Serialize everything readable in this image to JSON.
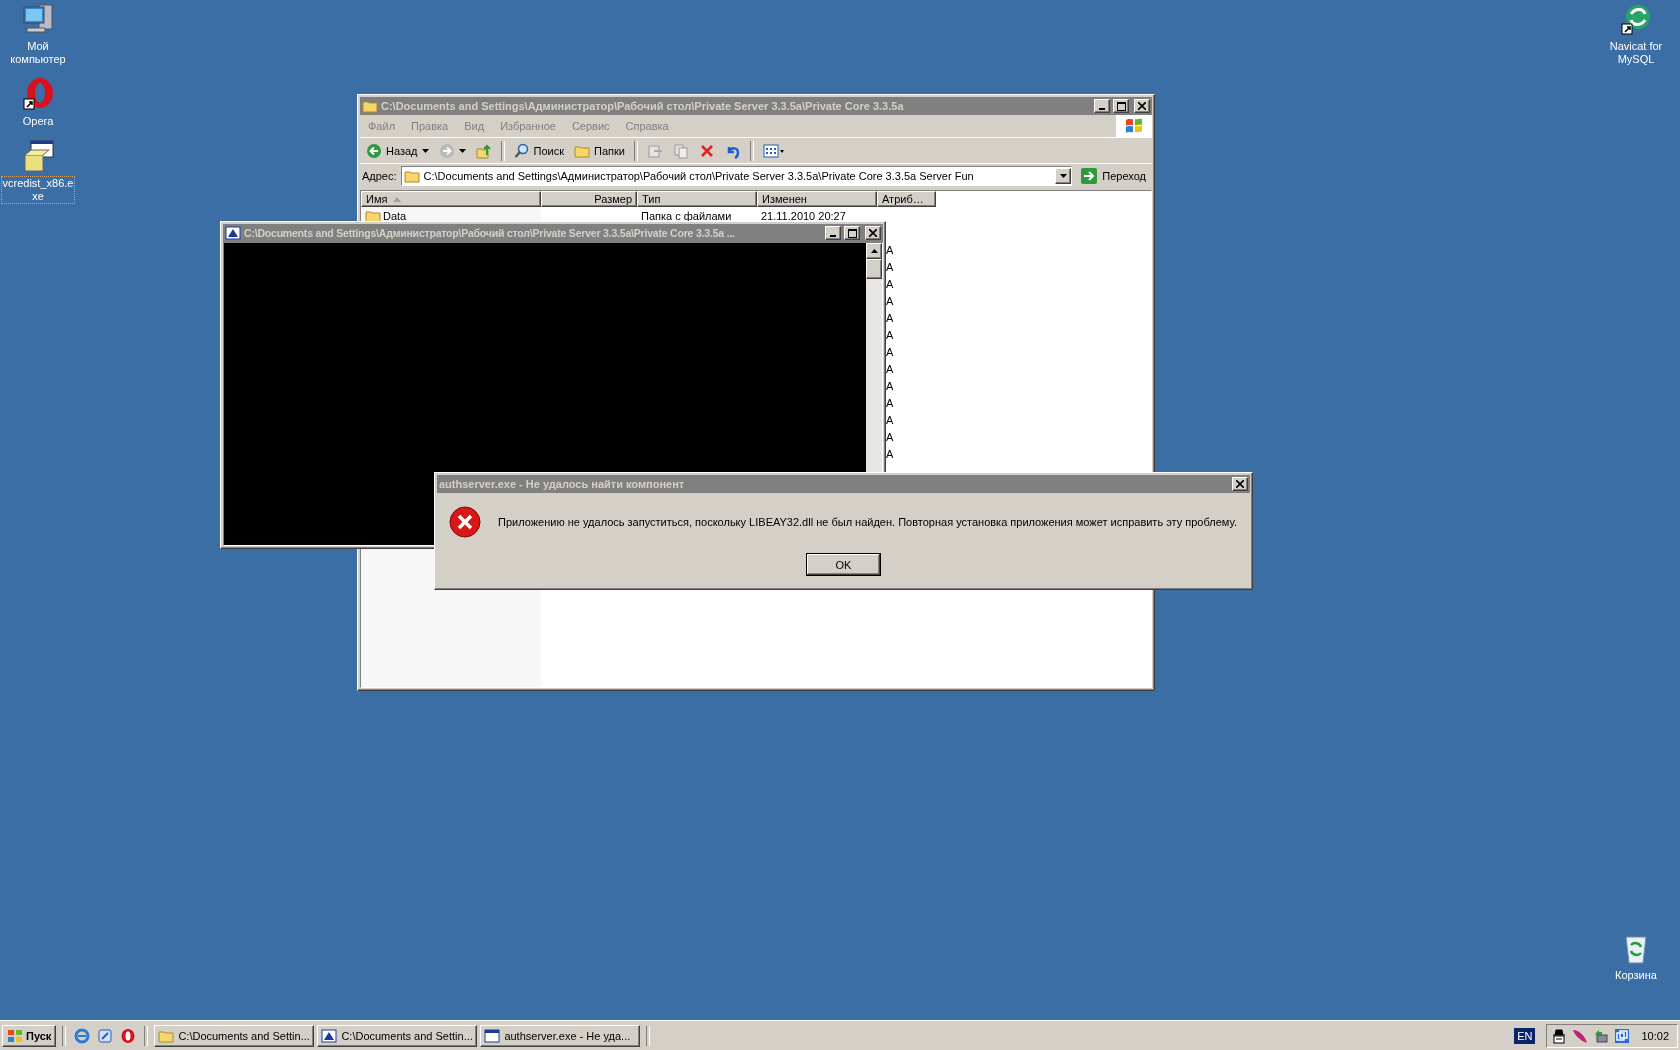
{
  "desktop_icons": [
    {
      "label": "Мой компьютер",
      "kind": "computer",
      "selected": false
    },
    {
      "label": "Opera",
      "kind": "opera",
      "selected": false
    },
    {
      "label": "vcredist_x86.exe",
      "kind": "installer",
      "selected": true
    }
  ],
  "desktop_icons_right": [
    {
      "label": "Navicat for MySQL",
      "kind": "navicat",
      "selected": false
    },
    {
      "label": "Корзина",
      "kind": "recycle",
      "selected": false
    }
  ],
  "explorer": {
    "title": "C:\\Documents and Settings\\Администратор\\Рабочий стол\\Private Server 3.3.5a\\Private Core 3.3.5a",
    "menu": [
      "Файл",
      "Правка",
      "Вид",
      "Избранное",
      "Сервис",
      "Справка"
    ],
    "toolbar": [
      {
        "kind": "back",
        "label": "Назад"
      },
      {
        "kind": "forward"
      },
      {
        "kind": "up"
      },
      {
        "kind": "search",
        "label": "Поиск"
      },
      {
        "kind": "folders",
        "label": "Папки"
      },
      {
        "kind": "move"
      },
      {
        "kind": "copy"
      },
      {
        "kind": "delete"
      },
      {
        "kind": "undo"
      },
      {
        "kind": "views"
      }
    ],
    "address": {
      "label": "Адрес:",
      "value": "C:\\Documents and Settings\\Администратор\\Рабочий стол\\Private Server 3.3.5a\\Private Core 3.3.5a Server Fun",
      "go": "Переход"
    },
    "columns": [
      "Имя",
      "Размер",
      "Тип",
      "Изменен",
      "Атриб…"
    ],
    "rows": [
      {
        "name": "Data",
        "type": "Папка с файлами",
        "modified": "21.11.2010 20:27"
      },
      {
        "attrib": "A"
      },
      {
        "attrib": "A"
      },
      {
        "attrib": "A"
      },
      {
        "attrib": "A"
      },
      {
        "attrib": "A"
      },
      {
        "attrib": "A"
      },
      {
        "attrib": "A"
      },
      {
        "attrib": "A"
      },
      {
        "attrib": "A"
      },
      {
        "attrib": "A"
      },
      {
        "attrib": "A"
      },
      {
        "attrib": "A"
      },
      {
        "attrib": "A"
      }
    ]
  },
  "console": {
    "title": "C:\\Documents and Settings\\Администратор\\Рабочий стол\\Private Server 3.3.5a\\Private Core 3.3.5a ..."
  },
  "dialog": {
    "title": "authserver.exe - Не удалось найти компонент",
    "message": "Приложению не удалось запуститься, поскольку LIBEAY32.dll не был найден. Повторная установка приложения может исправить эту проблему.",
    "button": "OK"
  },
  "taskbar": {
    "start": "Пуск",
    "quick_launch": [
      {
        "kind": "ie"
      },
      {
        "kind": "desktop"
      },
      {
        "kind": "opera"
      }
    ],
    "tasks": [
      {
        "kind": "folder",
        "label": "C:\\Documents and Settin..."
      },
      {
        "kind": "console",
        "label": "C:\\Documents and Settin..."
      },
      {
        "kind": "window",
        "label": "authserver.exe - Не уда..."
      }
    ],
    "language": "EN",
    "tray": [
      {
        "kind": "spy"
      },
      {
        "kind": "feather"
      },
      {
        "kind": "network"
      },
      {
        "kind": "vm"
      }
    ],
    "clock": "10:02"
  }
}
